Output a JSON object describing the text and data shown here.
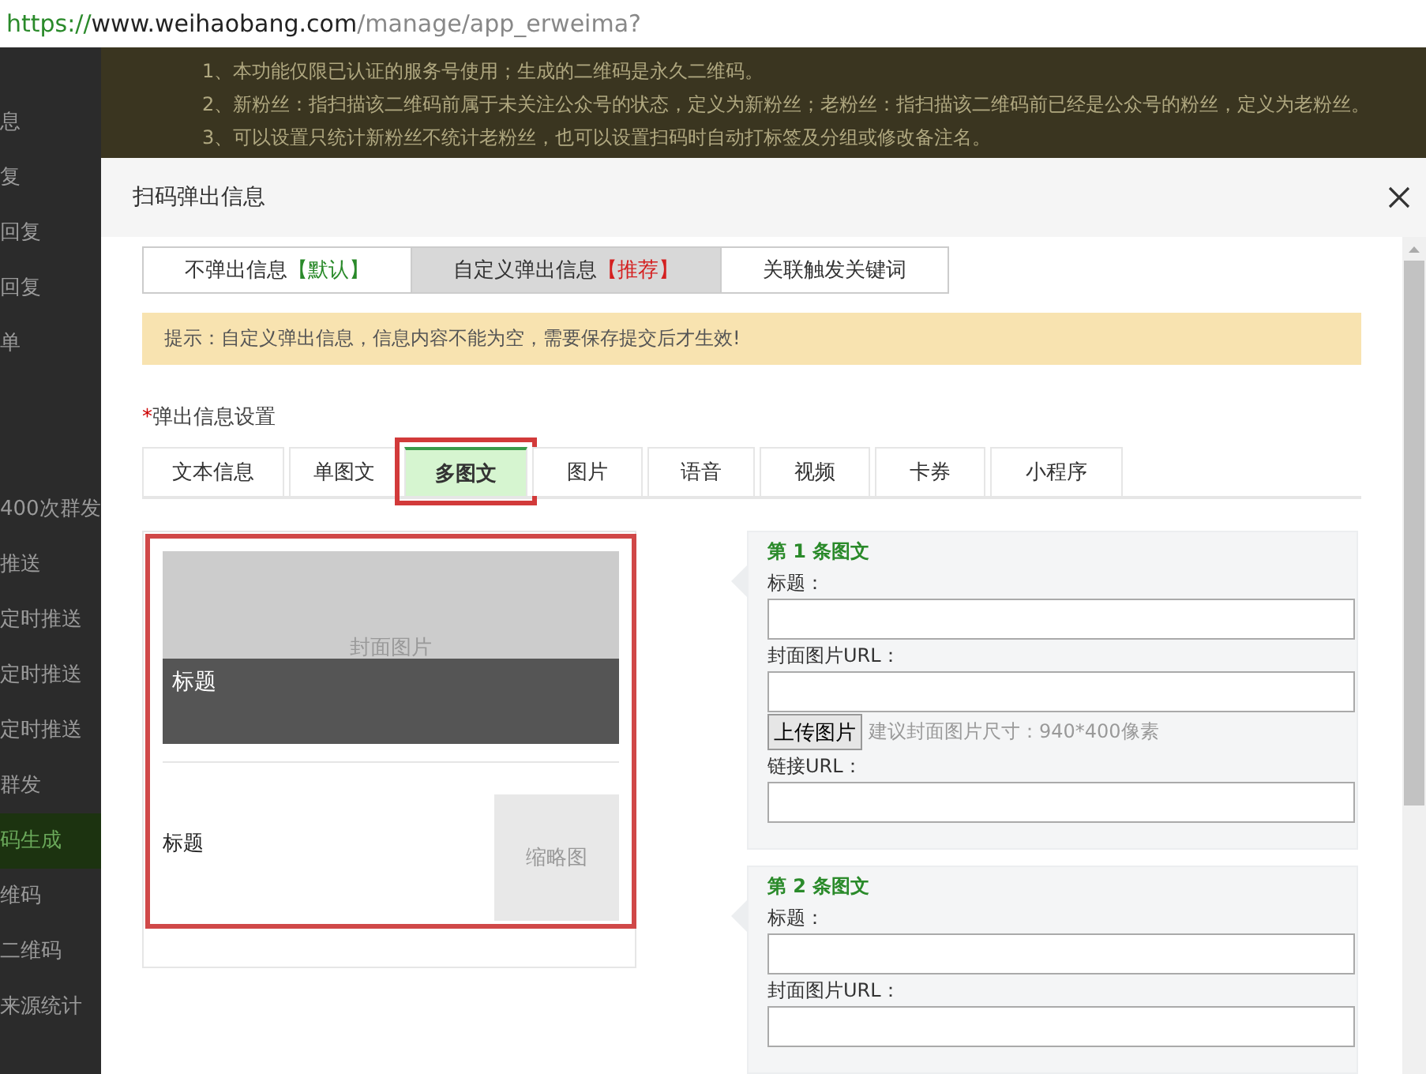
{
  "browser": {
    "scheme": "https://",
    "host": "www.weihaobang.com",
    "path": "/manage/app_erweima?"
  },
  "sidebar": {
    "items": [
      {
        "label": "息",
        "selected": false
      },
      {
        "label": "复",
        "selected": false
      },
      {
        "label": "回复",
        "selected": false
      },
      {
        "label": "回复",
        "selected": false
      },
      {
        "label": "单",
        "selected": false
      },
      {
        "label": "400次群发",
        "selected": false
      },
      {
        "label": "推送",
        "selected": false
      },
      {
        "label": "定时推送",
        "selected": false
      },
      {
        "label": "定时推送",
        "selected": false
      },
      {
        "label": "定时推送",
        "selected": false
      },
      {
        "label": "群发",
        "selected": false
      },
      {
        "label": "码生成",
        "selected": true
      },
      {
        "label": "维码",
        "selected": false
      },
      {
        "label": "二维码",
        "selected": false
      },
      {
        "label": "来源统计",
        "selected": false
      }
    ]
  },
  "notes": [
    "1、本功能仅限已认证的服务号使用；生成的二维码是永久二维码。",
    "2、新粉丝：指扫描该二维码前属于未关注公众号的状态，定义为新粉丝；老粉丝：指扫描该二维码前已经是公众号的粉丝，定义为老粉丝。",
    "3、可以设置只统计新粉丝不统计老粉丝，也可以设置扫码时自动打标签及分组或修改备注名。"
  ],
  "dialog": {
    "title": "扫码弹出信息",
    "mode_tabs": [
      {
        "label": "不弹出信息",
        "tag": "【默认】",
        "color": "#2a8a2a",
        "selected": false
      },
      {
        "label": "自定义弹出信息",
        "tag": "【推荐】",
        "color": "#d42020",
        "selected": true
      },
      {
        "label": "关联触发关键词",
        "selected": false
      }
    ],
    "notice": "提示：自定义弹出信息，信息内容不能为空，需要保存提交后才生效!",
    "section_mark": "*",
    "section_label": "弹出信息设置",
    "type_tabs": [
      {
        "label": "文本信息",
        "selected": false
      },
      {
        "label": "单图文",
        "selected": false
      },
      {
        "label": "多图文",
        "selected": true
      },
      {
        "label": "图片",
        "selected": false
      },
      {
        "label": "语音",
        "selected": false
      },
      {
        "label": "视频",
        "selected": false
      },
      {
        "label": "卡券",
        "selected": false
      },
      {
        "label": "小程序",
        "selected": false
      }
    ],
    "preview": {
      "cover_text": "封面图片",
      "cover_title": "标题",
      "item_title": "标题",
      "thumb_text": "缩略图"
    },
    "items": [
      {
        "heading": "第 1 条图文",
        "fields": [
          {
            "kind": "input",
            "label": "标题："
          },
          {
            "kind": "input",
            "label": "封面图片URL："
          },
          {
            "kind": "upload",
            "button": "上传图片",
            "hint": "建议封面图片尺寸：940*400像素"
          },
          {
            "kind": "input",
            "label": "链接URL："
          }
        ]
      },
      {
        "heading": "第 2 条图文",
        "fields": [
          {
            "kind": "input",
            "label": "标题："
          },
          {
            "kind": "input",
            "label": "封面图片URL："
          }
        ]
      }
    ]
  }
}
